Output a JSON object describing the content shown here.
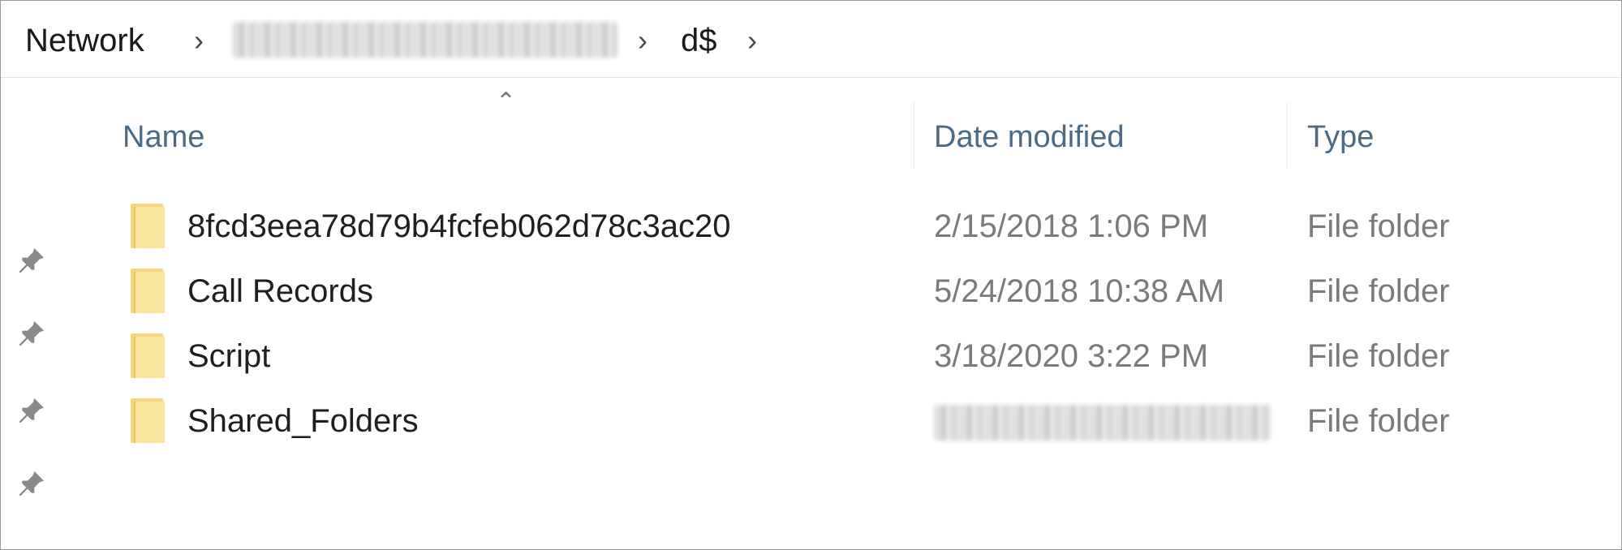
{
  "breadcrumb": {
    "items": [
      "Network",
      "d$"
    ],
    "separator": "›"
  },
  "columns": {
    "name": "Name",
    "date_modified": "Date modified",
    "type": "Type"
  },
  "rows": [
    {
      "name": "8fcd3eea78d79b4fcfeb062d78c3ac20",
      "date": "2/15/2018 1:06 PM",
      "type": "File folder"
    },
    {
      "name": "Call Records",
      "date": "5/24/2018 10:38 AM",
      "type": "File folder"
    },
    {
      "name": "Script",
      "date": "3/18/2020 3:22 PM",
      "type": "File folder"
    },
    {
      "name": "Shared_Folders",
      "date": "",
      "type": "File folder"
    }
  ],
  "icons": {
    "folder": "folder-icon",
    "pin": "pin-icon",
    "sort": "sort-ascending-icon"
  },
  "colors": {
    "header_text": "#4c6a86",
    "folder_yellow": "#f5d77a",
    "secondary_text": "#7a7a7a"
  }
}
